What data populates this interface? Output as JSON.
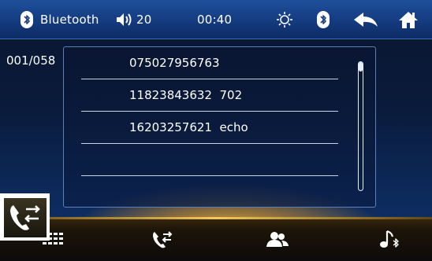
{
  "status_bar": {
    "source_label": "Bluetooth",
    "volume_value": "20",
    "clock": "00:40",
    "icons": [
      "bluetooth-icon",
      "speaker-icon",
      "brightness-icon",
      "bluetooth-icon",
      "back-arrow-icon",
      "home-icon"
    ]
  },
  "list": {
    "counter": "001/058",
    "rows": [
      {
        "text": "075027956763"
      },
      {
        "text": "11823843632  702"
      },
      {
        "text": "16203257621  echo"
      },
      {
        "text": ""
      }
    ],
    "scroll_position": 0.0
  },
  "bottom_bar": {
    "items": [
      {
        "name": "call-log",
        "icon": "call-log-icon",
        "selected": true
      },
      {
        "name": "dialpad",
        "icon": "dialpad-icon",
        "selected": false
      },
      {
        "name": "transfer-call",
        "icon": "call-transfer-icon",
        "selected": false
      },
      {
        "name": "contacts",
        "icon": "contacts-icon",
        "selected": false
      },
      {
        "name": "bt-music",
        "icon": "bluetooth-music-icon",
        "selected": false
      }
    ]
  },
  "colors": {
    "status_bar": "#163f85",
    "background": "#0b1730",
    "accent_glow": "#ffcc40",
    "text": "#ffffff"
  }
}
